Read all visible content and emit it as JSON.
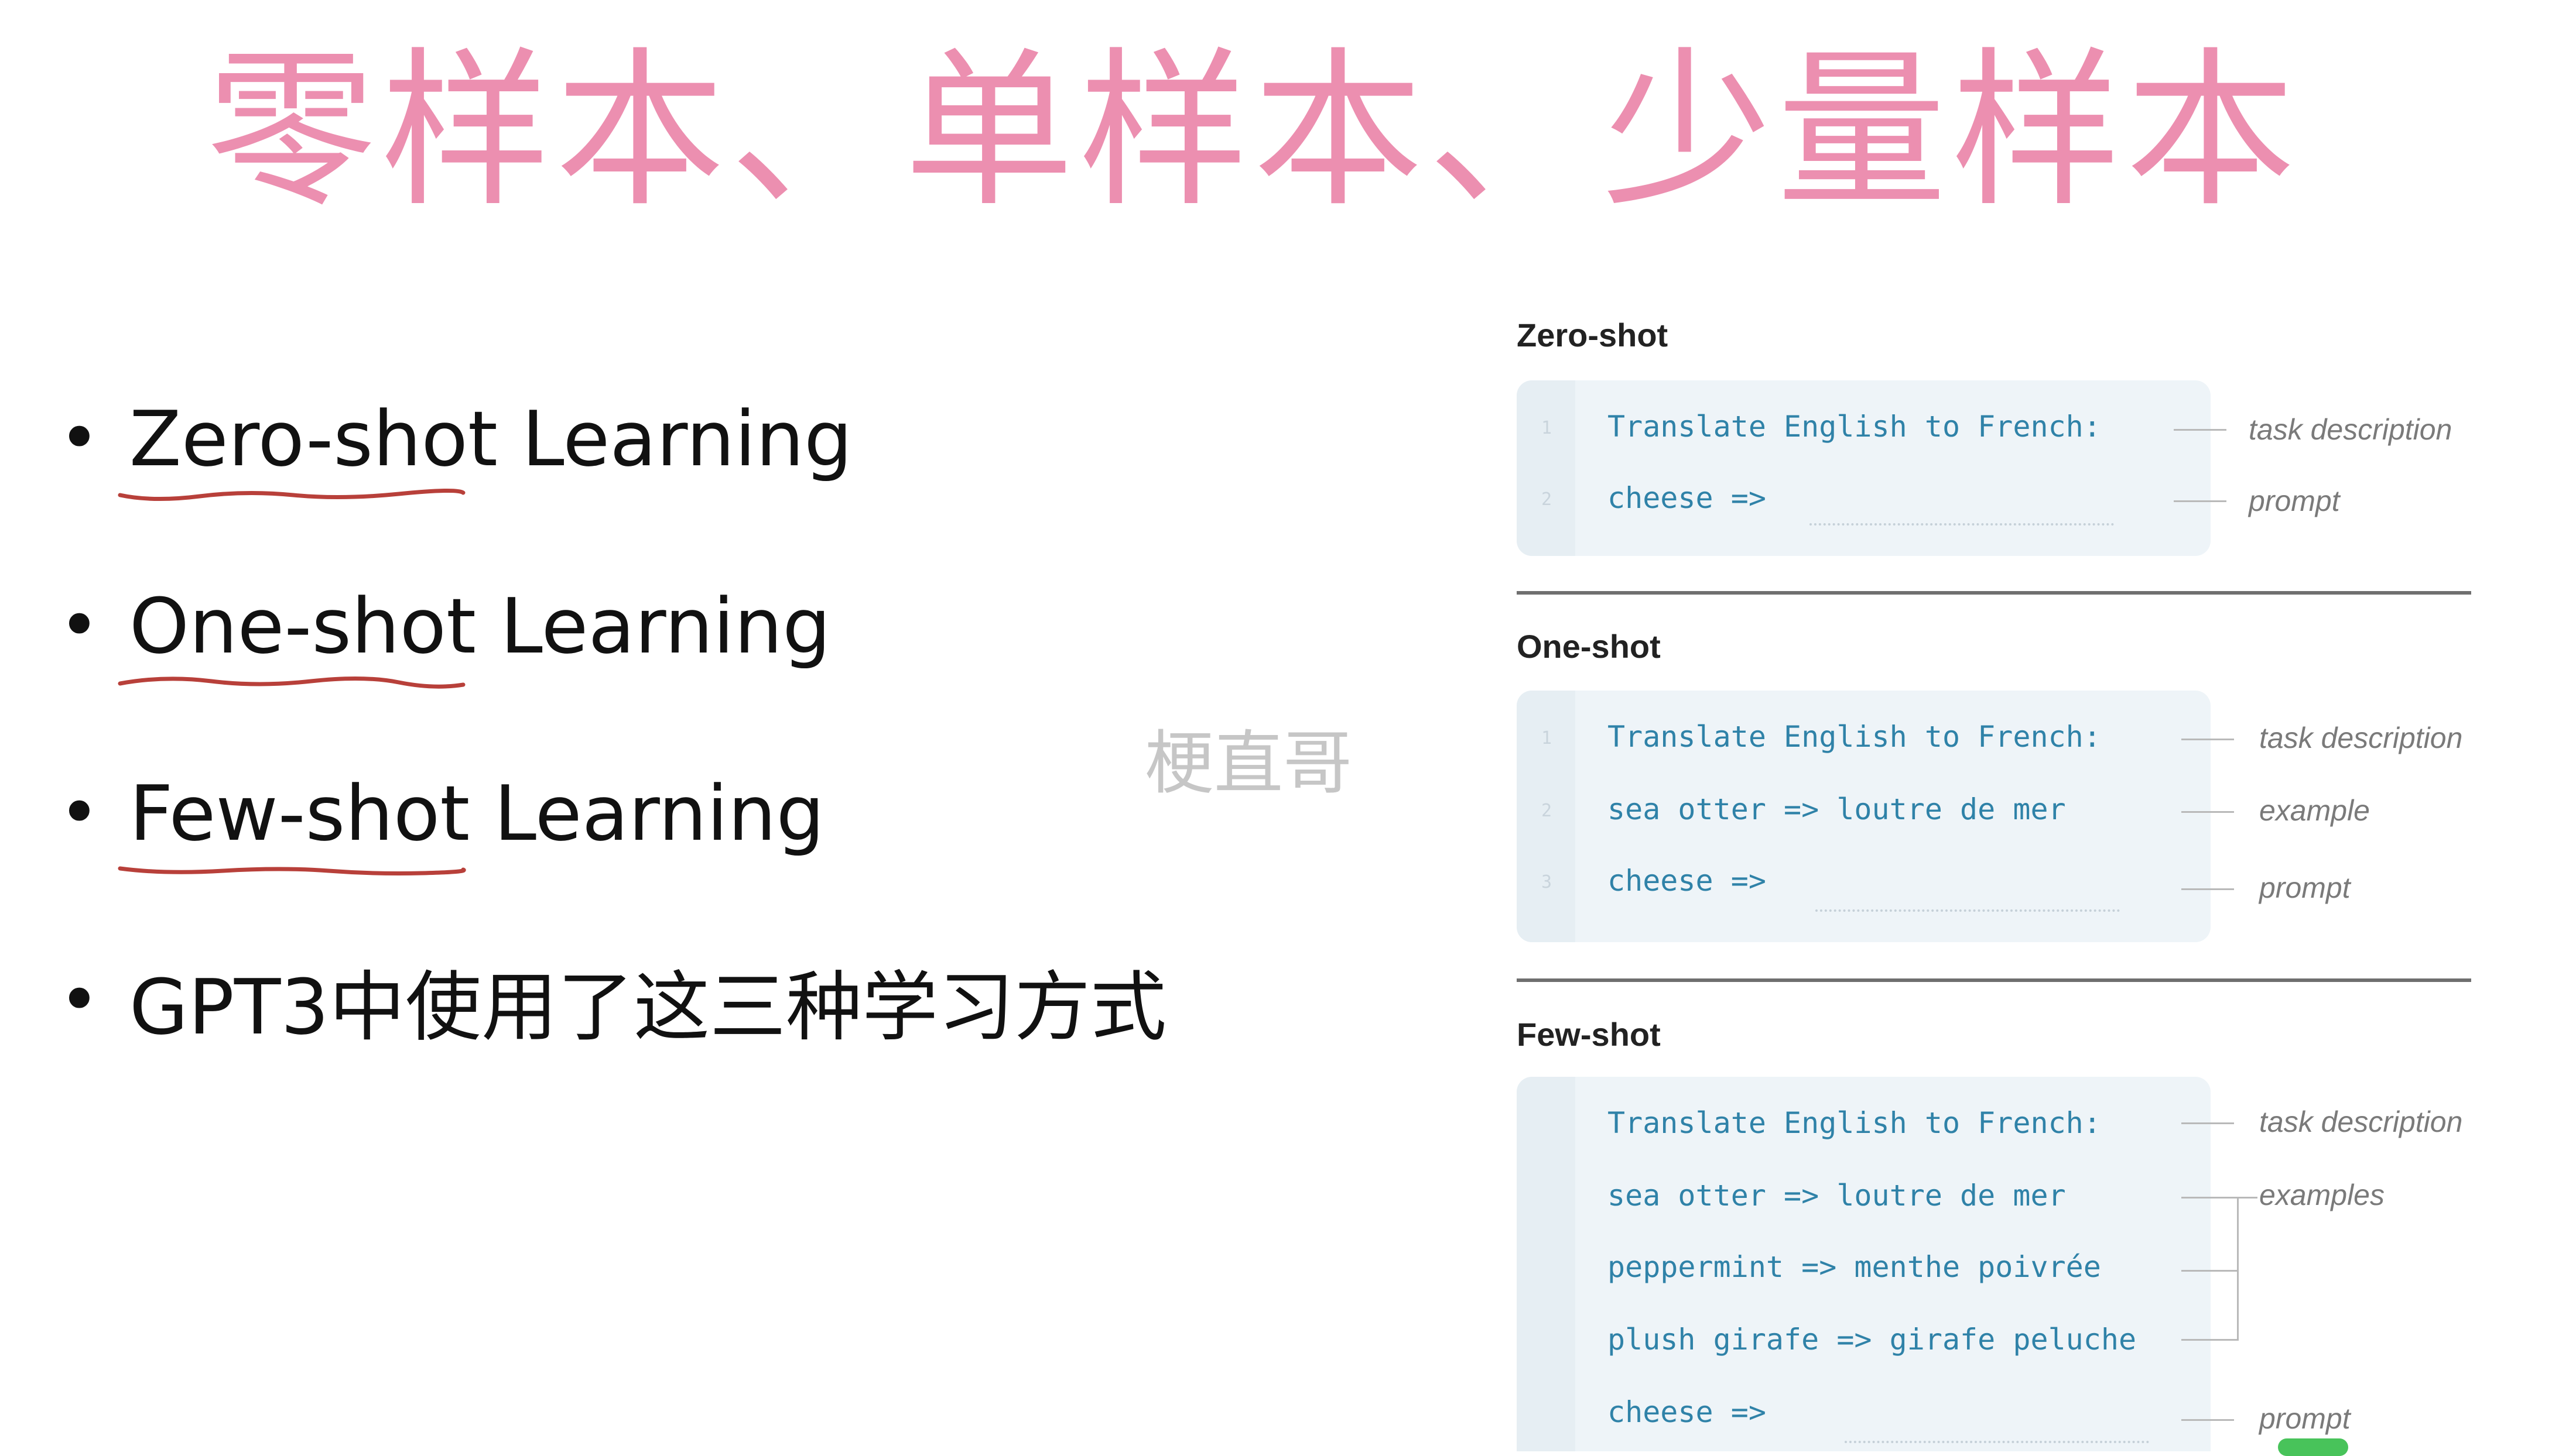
{
  "title": "零样本、单样本、少量样本",
  "bullets": [
    {
      "text": "Zero-shot Learning",
      "underlined": true
    },
    {
      "text": "One-shot Learning",
      "underlined": true
    },
    {
      "text": "Few-shot Learning",
      "underlined": true
    },
    {
      "text": "GPT3中使用了这三种学习方式",
      "underlined": false
    }
  ],
  "watermark": "梗直哥",
  "colors": {
    "title": "#ec8fb0",
    "code": "#2f82a8",
    "underline": "#b8403a"
  },
  "figure": {
    "zero": {
      "label": "Zero-shot",
      "lines": [
        "Translate English to French:",
        "cheese =>"
      ],
      "line_numbers": [
        "1",
        "2"
      ],
      "annotations": [
        "task description",
        "prompt"
      ]
    },
    "one": {
      "label": "One-shot",
      "lines": [
        "Translate English to French:",
        "sea otter => loutre de mer",
        "cheese =>"
      ],
      "line_numbers": [
        "1",
        "2",
        "3"
      ],
      "annotations": [
        "task description",
        "example",
        "prompt"
      ]
    },
    "few": {
      "label": "Few-shot",
      "lines": [
        "Translate English to French:",
        "sea otter => loutre de mer",
        "peppermint => menthe poivrée",
        "plush girafe => girafe peluche",
        "cheese =>"
      ],
      "annotations": [
        "task description",
        "examples",
        "prompt"
      ]
    }
  }
}
